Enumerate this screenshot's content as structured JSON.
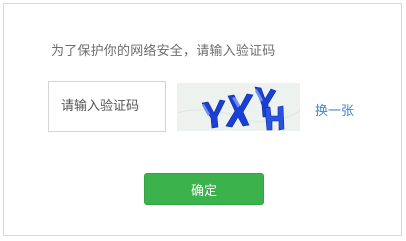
{
  "dialog": {
    "prompt": "为了保护你的网络安全，请输入验证码",
    "captcha_input": {
      "placeholder": "请输入验证码",
      "value": ""
    },
    "captcha_image": {
      "text": "YXYH",
      "colors": [
        "#1a3fd6",
        "#2a52e0"
      ]
    },
    "refresh_label": "换一张",
    "confirm_label": "确定"
  },
  "colors": {
    "confirm_button": "#3bb24c",
    "link": "#3b86d2",
    "border": "#d7d7d7"
  }
}
